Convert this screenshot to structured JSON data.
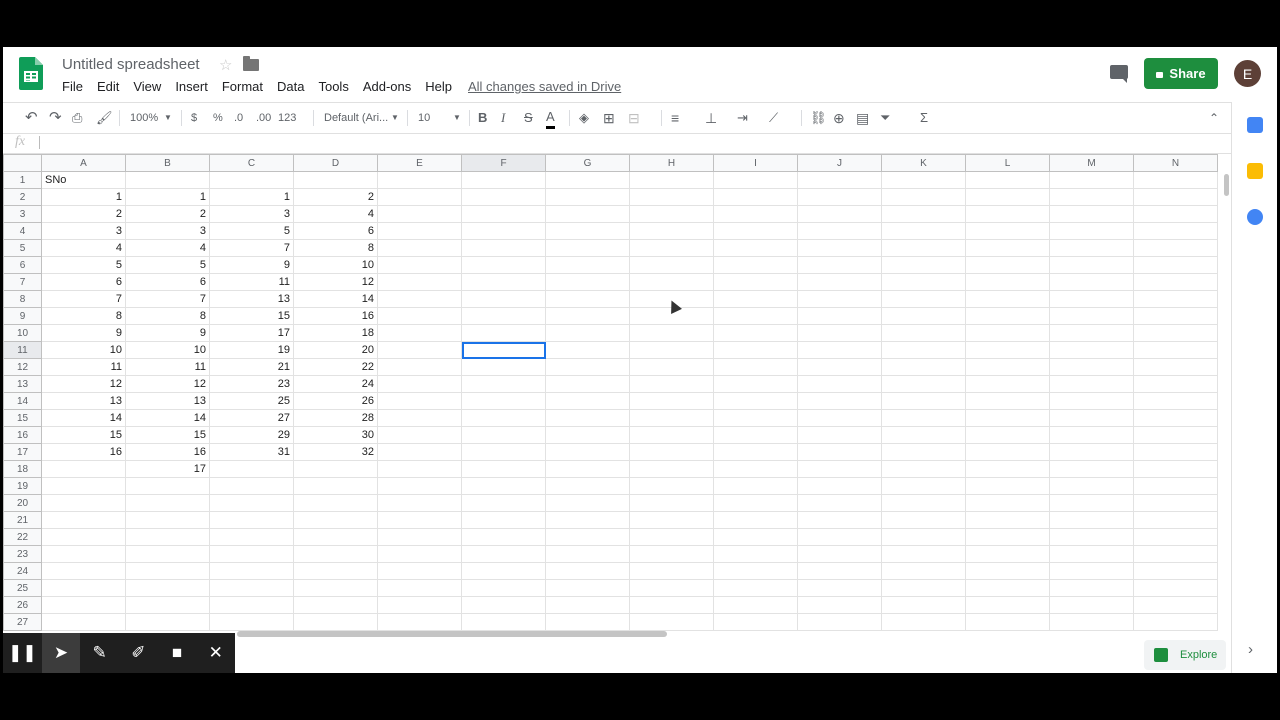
{
  "header": {
    "title": "Untitled spreadsheet",
    "menu": [
      "File",
      "Edit",
      "View",
      "Insert",
      "Format",
      "Data",
      "Tools",
      "Add-ons",
      "Help"
    ],
    "saved_status": "All changes saved in Drive",
    "share_label": "Share",
    "avatar_letter": "E"
  },
  "toolbar": {
    "zoom": "100%",
    "currency": "$",
    "percent": "%",
    "decrease_decimal": ".0",
    "increase_decimal": ".00",
    "more_formats": "123",
    "font": "Default (Ari...",
    "font_size": "10",
    "bold": "B",
    "italic": "I",
    "strike": "S",
    "text_color": "A",
    "sum": "Σ"
  },
  "formula_bar": {
    "fx": "fx",
    "value": ""
  },
  "grid": {
    "columns": [
      "A",
      "B",
      "C",
      "D",
      "E",
      "F",
      "G",
      "H",
      "I",
      "J",
      "K",
      "L",
      "M",
      "N"
    ],
    "selected_column": "F",
    "selected_row": "11",
    "rows": [
      [
        "SNo",
        "",
        "",
        ""
      ],
      [
        "1",
        "1",
        "1",
        "2"
      ],
      [
        "2",
        "2",
        "3",
        "4"
      ],
      [
        "3",
        "3",
        "5",
        "6"
      ],
      [
        "4",
        "4",
        "7",
        "8"
      ],
      [
        "5",
        "5",
        "9",
        "10"
      ],
      [
        "6",
        "6",
        "11",
        "12"
      ],
      [
        "7",
        "7",
        "13",
        "14"
      ],
      [
        "8",
        "8",
        "15",
        "16"
      ],
      [
        "9",
        "9",
        "17",
        "18"
      ],
      [
        "10",
        "10",
        "19",
        "20"
      ],
      [
        "11",
        "11",
        "21",
        "22"
      ],
      [
        "12",
        "12",
        "23",
        "24"
      ],
      [
        "13",
        "13",
        "25",
        "26"
      ],
      [
        "14",
        "14",
        "27",
        "28"
      ],
      [
        "15",
        "15",
        "29",
        "30"
      ],
      [
        "16",
        "16",
        "31",
        "32"
      ],
      [
        "",
        "17",
        "",
        ""
      ],
      [
        "",
        "",
        "",
        ""
      ],
      [
        "",
        "",
        "",
        ""
      ],
      [
        "",
        "",
        "",
        ""
      ],
      [
        "",
        "",
        "",
        ""
      ],
      [
        "",
        "",
        "",
        ""
      ],
      [
        "",
        "",
        "",
        ""
      ],
      [
        "",
        "",
        "",
        ""
      ],
      [
        "",
        "",
        "",
        ""
      ],
      [
        "",
        "",
        "",
        ""
      ]
    ]
  },
  "explore_label": "Explore",
  "colors": {
    "brand_green": "#1e8e3e",
    "selection_blue": "#1a73e8"
  }
}
